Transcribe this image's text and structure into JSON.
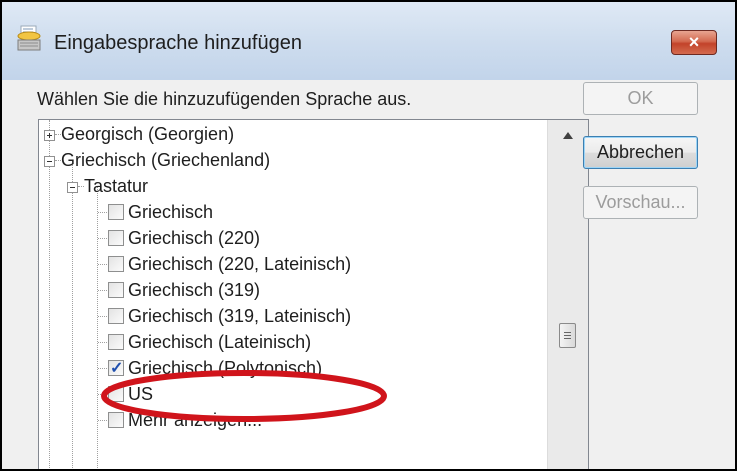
{
  "window": {
    "title": "Eingabesprache hinzufügen",
    "close_label": "×"
  },
  "instruction": "Wählen Sie die hinzuzufügenden Sprache aus.",
  "buttons": {
    "ok": "OK",
    "cancel": "Abbrechen",
    "preview": "Vorschau..."
  },
  "tree": {
    "georgisch": "Georgisch (Georgien)",
    "griechisch": "Griechisch (Griechenland)",
    "tastatur": "Tastatur",
    "items": [
      {
        "label": "Griechisch",
        "checked": false
      },
      {
        "label": "Griechisch (220)",
        "checked": false
      },
      {
        "label": "Griechisch (220, Lateinisch)",
        "checked": false
      },
      {
        "label": "Griechisch (319)",
        "checked": false
      },
      {
        "label": "Griechisch (319, Lateinisch)",
        "checked": false
      },
      {
        "label": "Griechisch (Lateinisch)",
        "checked": false
      },
      {
        "label": "Griechisch (Polytonisch)",
        "checked": true
      },
      {
        "label": "US",
        "checked": false
      },
      {
        "label": "Mehr anzeigen...",
        "checked": false
      }
    ]
  },
  "colors": {
    "highlight_ellipse": "#d0141b",
    "close_button": "#c2432a"
  },
  "icons": {
    "title": "keyboard-language-icon",
    "close": "close-icon"
  }
}
